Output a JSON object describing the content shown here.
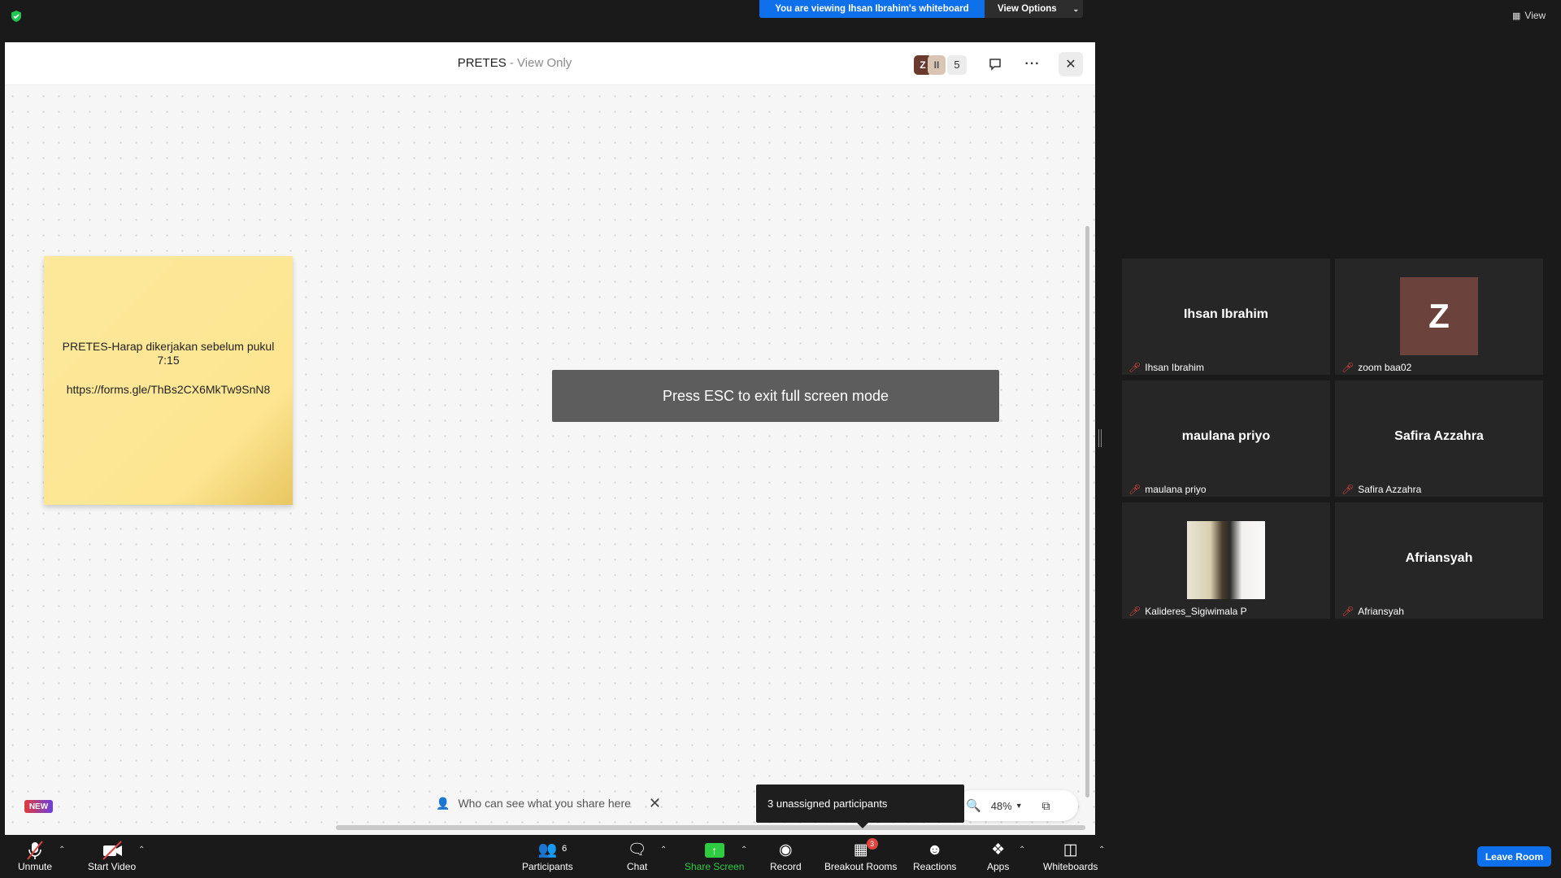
{
  "top_bar": {
    "viewing_banner": "You are viewing Ihsan Ibrahim's whiteboard",
    "view_options": "View Options",
    "view_button": "View"
  },
  "whiteboard": {
    "title": "PRETES",
    "mode": " - View Only",
    "avatars": [
      "Z",
      "II"
    ],
    "participant_count": "5",
    "sticky_note": {
      "line1": "PRETES-Harap dikerjakan sebelum pukul 7:15",
      "line2": "https://forms.gle/ThBs2CX6MkTw9SnN8"
    },
    "esc_toast": "Press ESC to exit full screen mode",
    "new_badge": "NEW",
    "share_hint": "Who can see what you share here",
    "zoom_level": "48%",
    "tooltip": "3 unassigned participants"
  },
  "gallery": [
    {
      "name": "Ihsan Ibrahim",
      "label": "Ihsan Ibrahim",
      "display": "name"
    },
    {
      "name": "Z",
      "label": "zoom baa02",
      "display": "avatar"
    },
    {
      "name": "maulana priyo",
      "label": "maulana priyo",
      "display": "name"
    },
    {
      "name": "Safira Azzahra",
      "label": "Safira Azzahra",
      "display": "name"
    },
    {
      "name": "",
      "label": "Kalideres_Sigiwimala P",
      "display": "photo"
    },
    {
      "name": "Afriansyah",
      "label": "Afriansyah",
      "display": "name"
    }
  ],
  "toolbar": {
    "unmute": "Unmute",
    "start_video": "Start Video",
    "participants": "Participants",
    "participants_count": "6",
    "chat": "Chat",
    "share_screen": "Share Screen",
    "record": "Record",
    "breakout_rooms": "Breakout Rooms",
    "breakout_badge": "3",
    "reactions": "Reactions",
    "apps": "Apps",
    "whiteboards": "Whiteboards",
    "leave_room": "Leave Room"
  },
  "colors": {
    "accent_blue": "#0e71eb",
    "share_green": "#2ecc40",
    "mic_off_red": "#e0443e",
    "sticky_yellow": "#fde89b"
  }
}
